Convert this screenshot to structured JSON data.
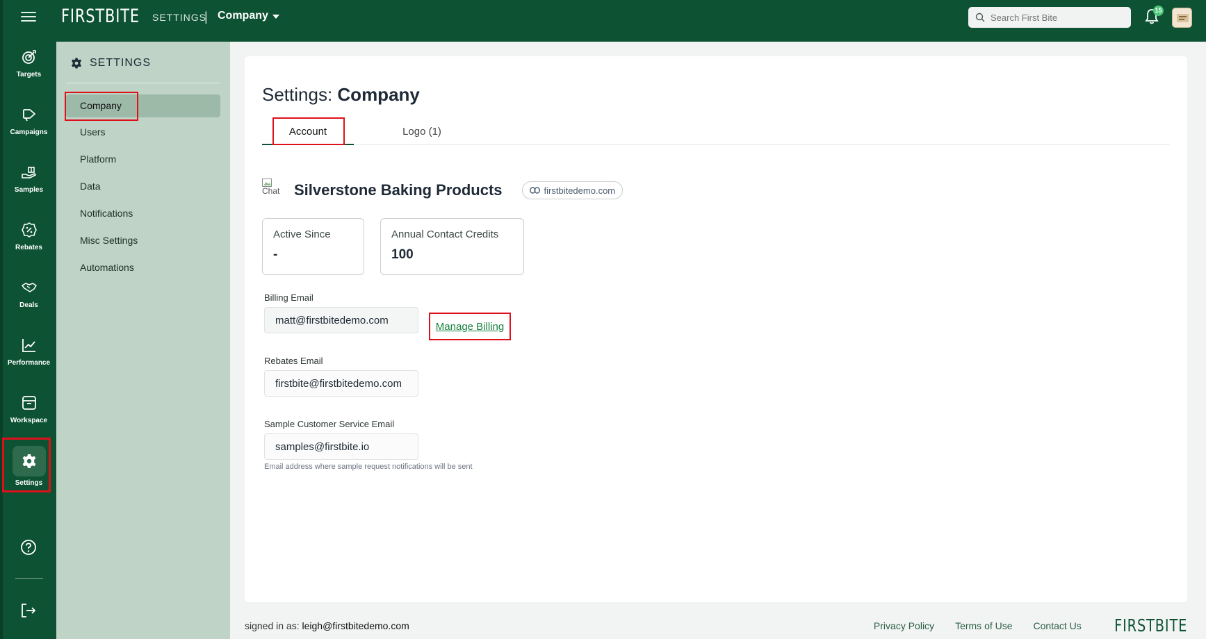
{
  "app": {
    "logo": "FIRSTBITE",
    "section": "SETTINGS",
    "separator": "|",
    "company_selector": "Company"
  },
  "search": {
    "placeholder": "Search First Bite"
  },
  "notifications": {
    "count": "15"
  },
  "rail": {
    "items": [
      {
        "label": "Targets",
        "icon": "target-icon"
      },
      {
        "label": "Campaigns",
        "icon": "megaphone-icon"
      },
      {
        "label": "Samples",
        "icon": "hand-gift-icon"
      },
      {
        "label": "Rebates",
        "icon": "percent-badge-icon"
      },
      {
        "label": "Deals",
        "icon": "handshake-icon"
      },
      {
        "label": "Performance",
        "icon": "line-chart-icon"
      },
      {
        "label": "Workspace",
        "icon": "archive-box-icon"
      },
      {
        "label": "Settings",
        "icon": "gear-icon",
        "active": true
      }
    ]
  },
  "settings_menu": {
    "title": "SETTINGS",
    "items": [
      {
        "label": "Company",
        "active": true
      },
      {
        "label": "Users"
      },
      {
        "label": "Platform"
      },
      {
        "label": "Data"
      },
      {
        "label": "Notifications"
      },
      {
        "label": "Misc Settings"
      },
      {
        "label": "Automations"
      }
    ]
  },
  "page": {
    "title_prefix": "Settings: ",
    "title_bold": "Company",
    "tabs": [
      {
        "label": "Account",
        "active": true
      },
      {
        "label": "Logo (1)"
      }
    ],
    "broken_image_alt": "Chat",
    "company_name": "Silverstone Baking Products",
    "domain": "firstbitedemo.com",
    "stats": [
      {
        "label": "Active Since",
        "value": "-"
      },
      {
        "label": "Annual Contact Credits",
        "value": "100"
      }
    ],
    "billing_email_label": "Billing Email",
    "billing_email": "matt@firstbitedemo.com",
    "manage_billing": "Manage Billing",
    "rebates_email_label": "Rebates Email",
    "rebates_email": "firstbite@firstbitedemo.com",
    "sample_email_label": "Sample Customer Service Email",
    "sample_email": "samples@firstbite.io",
    "sample_email_hint": "Email address where sample request notifications will be sent"
  },
  "footer": {
    "signed_in_prefix": "signed in as: ",
    "signed_in_user": "leigh@firstbitedemo.com",
    "privacy": "Privacy Policy",
    "terms": "Terms of Use",
    "contact": "Contact Us",
    "logo": "FIRSTBITE"
  },
  "colors": {
    "brand_green": "#0d5233",
    "sidebar_green": "#bfd3c6",
    "highlight_red": "#e0101a",
    "link_green": "#15803d"
  }
}
